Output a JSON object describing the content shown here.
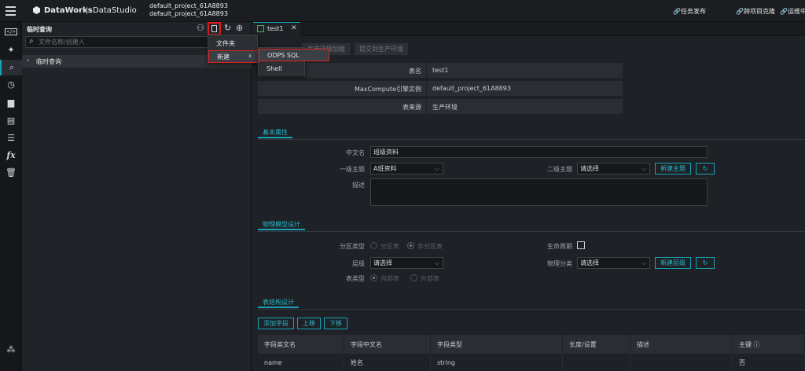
{
  "topbar": {
    "logo_text": "DataWorks",
    "app_name": "DataStudio",
    "separator": "|",
    "project_line1": "default_project_61A8893",
    "project_line2": "default_project_61A8893",
    "actions": [
      "任务发布",
      "跨项目克隆",
      "运维中"
    ]
  },
  "sidebar_rail": {
    "icons": [
      "menu-icon",
      "code-icon",
      "puzzle-icon",
      "search-icon",
      "clock-icon",
      "toolbox-icon",
      "table-icon",
      "list-icon",
      "function-icon",
      "trash-icon",
      "graph-icon"
    ],
    "fx_label": "fx"
  },
  "panel": {
    "title": "临时查询",
    "search_placeholder": "文件名称/创建人",
    "tree_item": "临时查询"
  },
  "context_menu": {
    "items": [
      "文件夹",
      "新建"
    ],
    "submenu": [
      "ODPS SQL",
      "Shell"
    ]
  },
  "editor": {
    "tab_label": "test1",
    "toolbar": [
      "生产环境加载",
      "提交到生产环境"
    ],
    "info_rows": [
      {
        "key": "表名",
        "value": "test1"
      },
      {
        "key": "MaxCompute引擎实例",
        "value": "default_project_61A8893"
      },
      {
        "key": "表来源",
        "value": "生产环境"
      }
    ],
    "basic": {
      "section_title": "基本属性",
      "cn_name_label": "中文名",
      "cn_name_value": "班级资料",
      "level1_label": "一级主题",
      "level1_value": "A班资料",
      "level2_label": "二级主题",
      "level2_value": "请选择",
      "new_theme_button": "新建主题",
      "desc_label": "描述"
    },
    "physical": {
      "section_title": "物理模型设计",
      "partition_label": "分区类型",
      "partition_opt1": "分区表",
      "partition_opt2": "非分区表",
      "lifecycle_label": "生命周期",
      "layer_label": "层级",
      "layer_value": "请选择",
      "category_label": "物理分类",
      "category_value": "请选择",
      "new_layer_button": "新建层级",
      "tabletype_label": "表类型",
      "tabletype_opt1": "内部表",
      "tabletype_opt2": "外部表"
    },
    "structure": {
      "section_title": "表结构设计",
      "buttons": [
        "添加字段",
        "上移",
        "下移"
      ],
      "columns": [
        "字段英文名",
        "字段中文名",
        "字段类型",
        "长度/设置",
        "描述",
        "主键 ⓘ"
      ],
      "rows": [
        [
          "name",
          "姓名",
          "string",
          "",
          "",
          "否"
        ]
      ]
    }
  },
  "colors": {
    "accent": "#1aa3b8",
    "highlight_border": "#e02020",
    "background": "#1e2125"
  }
}
